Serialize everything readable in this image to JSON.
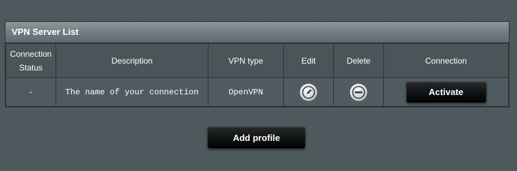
{
  "panel": {
    "title": "VPN Server List"
  },
  "table": {
    "headers": {
      "status_line1": "Connection",
      "status_line2": "Status",
      "description": "Description",
      "vpn_type": "VPN type",
      "edit": "Edit",
      "delete": "Delete",
      "connection": "Connection"
    },
    "rows": [
      {
        "status": "-",
        "description": "The name of your connection",
        "vpn_type": "OpenVPN",
        "edit_icon": "pencil-icon",
        "delete_icon": "minus-circle-icon",
        "connection_label": "Activate"
      }
    ]
  },
  "actions": {
    "add_profile_label": "Add profile"
  },
  "colors": {
    "background": "#4d595d",
    "header_gradient_top": "#8e989c",
    "button_dark": "#000000"
  }
}
